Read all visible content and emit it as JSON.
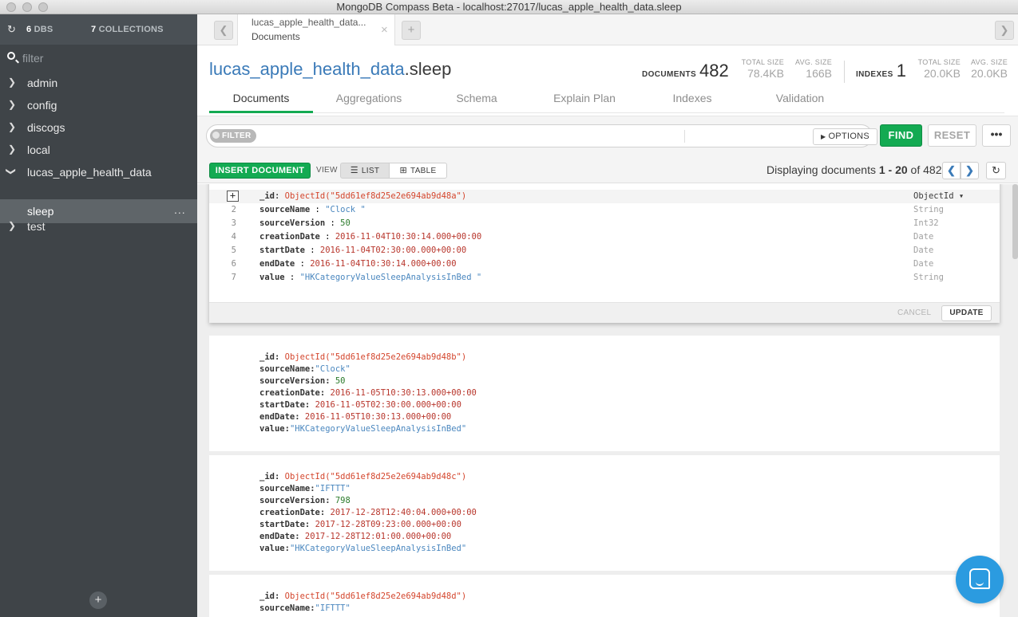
{
  "window": {
    "title": "MongoDB Compass Beta - localhost:27017/lucas_apple_health_data.sleep"
  },
  "sidebar": {
    "dbs_count": "6",
    "dbs_label": "DBS",
    "collections_count": "7",
    "collections_label": "COLLECTIONS",
    "filter_placeholder": "filter",
    "databases": [
      "admin",
      "config",
      "discogs",
      "local",
      "lucas_apple_health_data"
    ],
    "collection": "sleep",
    "collection_actions": "...",
    "last_database": "test",
    "add_button": "+"
  },
  "tabs": {
    "active_title": "lucas_apple_health_data...",
    "active_subtitle": "Documents",
    "close": "×",
    "add": "+"
  },
  "header": {
    "db": "lucas_apple_health_data",
    "collection": ".sleep",
    "documents_label": "DOCUMENTS",
    "documents_count": "482",
    "total_size_label": "TOTAL SIZE",
    "total_size": "78.4KB",
    "avg_size_label": "AVG. SIZE",
    "avg_size": "166B",
    "indexes_label": "INDEXES",
    "indexes_count": "1",
    "index_total_size_label": "TOTAL SIZE",
    "index_total_size": "20.0KB",
    "index_avg_size_label": "AVG. SIZE",
    "index_avg_size": "20.0KB"
  },
  "subtabs": [
    "Documents",
    "Aggregations",
    "Schema",
    "Explain Plan",
    "Indexes",
    "Validation"
  ],
  "query": {
    "filter_label": "FILTER",
    "options_label": "OPTIONS",
    "find_label": "FIND",
    "reset_label": "RESET",
    "more_label": "•••"
  },
  "toolbar": {
    "insert_label": "INSERT DOCUMENT",
    "view_label": "VIEW",
    "list_label": "LIST",
    "table_label": "TABLE",
    "display_prefix": "Displaying documents ",
    "range": "1 - 20",
    "display_of": " of ",
    "total": "482"
  },
  "editor": {
    "expand": "+",
    "cancel_label": "CANCEL",
    "update_label": "UPDATE",
    "rows": [
      {
        "line": "",
        "key": "_id",
        "sep": ": ",
        "value": "ObjectId(\"5dd61ef8d25e2e694ab9d48a\")",
        "kind": "oid",
        "type": "ObjectId ▾"
      },
      {
        "line": "2",
        "key": "sourceName",
        "sep": " : ",
        "value": "\"Clock \"",
        "kind": "str",
        "type": "String"
      },
      {
        "line": "3",
        "key": "sourceVersion",
        "sep": " : ",
        "value": "50",
        "kind": "num",
        "type": "Int32"
      },
      {
        "line": "4",
        "key": "creationDate",
        "sep": " : ",
        "value": "2016-11-04T10:30:14.000+00:00",
        "kind": "date",
        "type": "Date"
      },
      {
        "line": "5",
        "key": "startDate",
        "sep": " : ",
        "value": "2016-11-04T02:30:00.000+00:00",
        "kind": "date",
        "type": "Date"
      },
      {
        "line": "6",
        "key": "endDate",
        "sep": " : ",
        "value": "2016-11-04T10:30:14.000+00:00",
        "kind": "date",
        "type": "Date"
      },
      {
        "line": "7",
        "key": "value",
        "sep": " : ",
        "value": "\"HKCategoryValueSleepAnalysisInBed \"",
        "kind": "str",
        "type": "String"
      }
    ]
  },
  "documents": [
    {
      "fields": [
        {
          "key": "_id",
          "value": "ObjectId(\"5dd61ef8d25e2e694ab9d48b\")",
          "kind": "oid"
        },
        {
          "key": "sourceName",
          "value": "\"Clock\"",
          "kind": "str"
        },
        {
          "key": "sourceVersion",
          "value": "50",
          "kind": "num"
        },
        {
          "key": "creationDate",
          "value": "2016-11-05T10:30:13.000+00:00",
          "kind": "date"
        },
        {
          "key": "startDate",
          "value": "2016-11-05T02:30:00.000+00:00",
          "kind": "date"
        },
        {
          "key": "endDate",
          "value": "2016-11-05T10:30:13.000+00:00",
          "kind": "date"
        },
        {
          "key": "value",
          "value": "\"HKCategoryValueSleepAnalysisInBed\"",
          "kind": "str"
        }
      ]
    },
    {
      "fields": [
        {
          "key": "_id",
          "value": "ObjectId(\"5dd61ef8d25e2e694ab9d48c\")",
          "kind": "oid"
        },
        {
          "key": "sourceName",
          "value": "\"IFTTT\"",
          "kind": "str"
        },
        {
          "key": "sourceVersion",
          "value": "798",
          "kind": "num"
        },
        {
          "key": "creationDate",
          "value": "2017-12-28T12:40:04.000+00:00",
          "kind": "date"
        },
        {
          "key": "startDate",
          "value": "2017-12-28T09:23:00.000+00:00",
          "kind": "date"
        },
        {
          "key": "endDate",
          "value": "2017-12-28T12:01:00.000+00:00",
          "kind": "date"
        },
        {
          "key": "value",
          "value": "\"HKCategoryValueSleepAnalysisInBed\"",
          "kind": "str"
        }
      ]
    },
    {
      "fields": [
        {
          "key": "_id",
          "value": "ObjectId(\"5dd61ef8d25e2e694ab9d48d\")",
          "kind": "oid"
        },
        {
          "key": "sourceName",
          "value": "\"IFTTT\"",
          "kind": "str"
        }
      ]
    }
  ],
  "icons": {
    "refresh": "refresh-icon",
    "search": "search-icon",
    "chevron_right": "chevron-right-icon",
    "chevron_down": "chevron-down-icon",
    "chat": "chat-icon"
  },
  "colors": {
    "accent_green": "#13aa52",
    "link_blue": "#3a7ab8",
    "sidebar_bg": "#3f4448",
    "oid_red": "#d4462d",
    "string_blue": "#4a87bf"
  }
}
